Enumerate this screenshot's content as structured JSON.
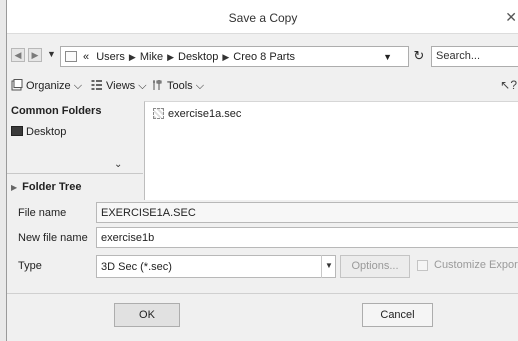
{
  "window": {
    "title": "Save a Copy"
  },
  "address": {
    "crumbs": [
      "«",
      "Users",
      "Mike",
      "Desktop",
      "Creo 8 Parts"
    ],
    "search_placeholder": "Search..."
  },
  "toolbar": {
    "organize": "Organize",
    "views": "Views",
    "tools": "Tools"
  },
  "left_pane": {
    "common_folders": "Common Folders",
    "desktop": "Desktop",
    "folder_tree": "Folder Tree"
  },
  "files": [
    {
      "name": "exercise1a.sec"
    }
  ],
  "form": {
    "file_name_label": "File name",
    "file_name_value": "EXERCISE1A.SEC",
    "new_file_name_label": "New file name",
    "new_file_name_value": "exercise1b",
    "type_label": "Type",
    "type_value": "3D Sec (*.sec)",
    "options_label": "Options...",
    "customize_export_label": "Customize Export",
    "customize_export_checked": false
  },
  "buttons": {
    "ok": "OK",
    "cancel": "Cancel"
  }
}
